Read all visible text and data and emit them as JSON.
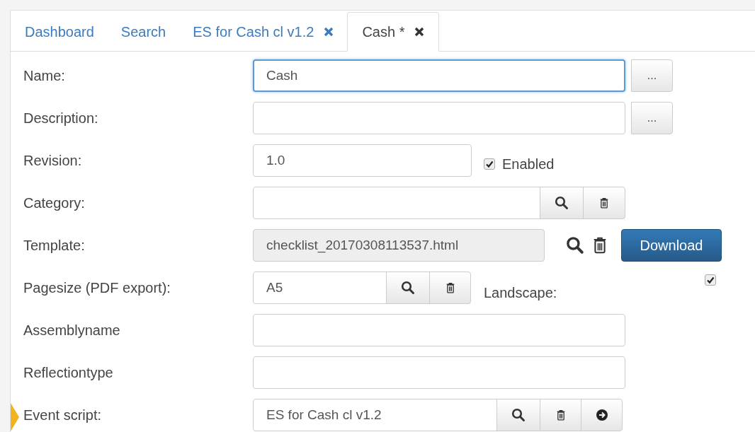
{
  "tabs": [
    {
      "label": "Dashboard",
      "selected": false
    },
    {
      "label": "Search",
      "selected": false
    },
    {
      "label": "ES for Cash cl v1.2",
      "selected": false,
      "closable": true
    },
    {
      "label": "Cash *",
      "selected": true,
      "closable": true
    }
  ],
  "fields": [
    {
      "kind": "text-more",
      "label": "Name:",
      "value": "Cash",
      "focused": true,
      "button": "..."
    },
    {
      "kind": "text-more",
      "label": "Description:",
      "button": "..."
    },
    {
      "kind": "text-check",
      "label": "Revision:",
      "value": "1.0",
      "check_label": "Enabled",
      "checked": true
    },
    {
      "kind": "lookup",
      "label": "Category:"
    },
    {
      "kind": "template",
      "label": "Template:",
      "value": "checklist_20170308113537.html",
      "button": "Download"
    },
    {
      "kind": "lookup-check",
      "label": "Pagesize (PDF export):",
      "value": "A5",
      "check_label": "Landscape:",
      "checked": true
    },
    {
      "kind": "text",
      "label": "Assemblyname"
    },
    {
      "kind": "text",
      "label": "Reflectiontype"
    },
    {
      "kind": "lookup-go",
      "label": "Event script:",
      "value": "ES for Cash cl v1.2",
      "pointer": true
    }
  ]
}
